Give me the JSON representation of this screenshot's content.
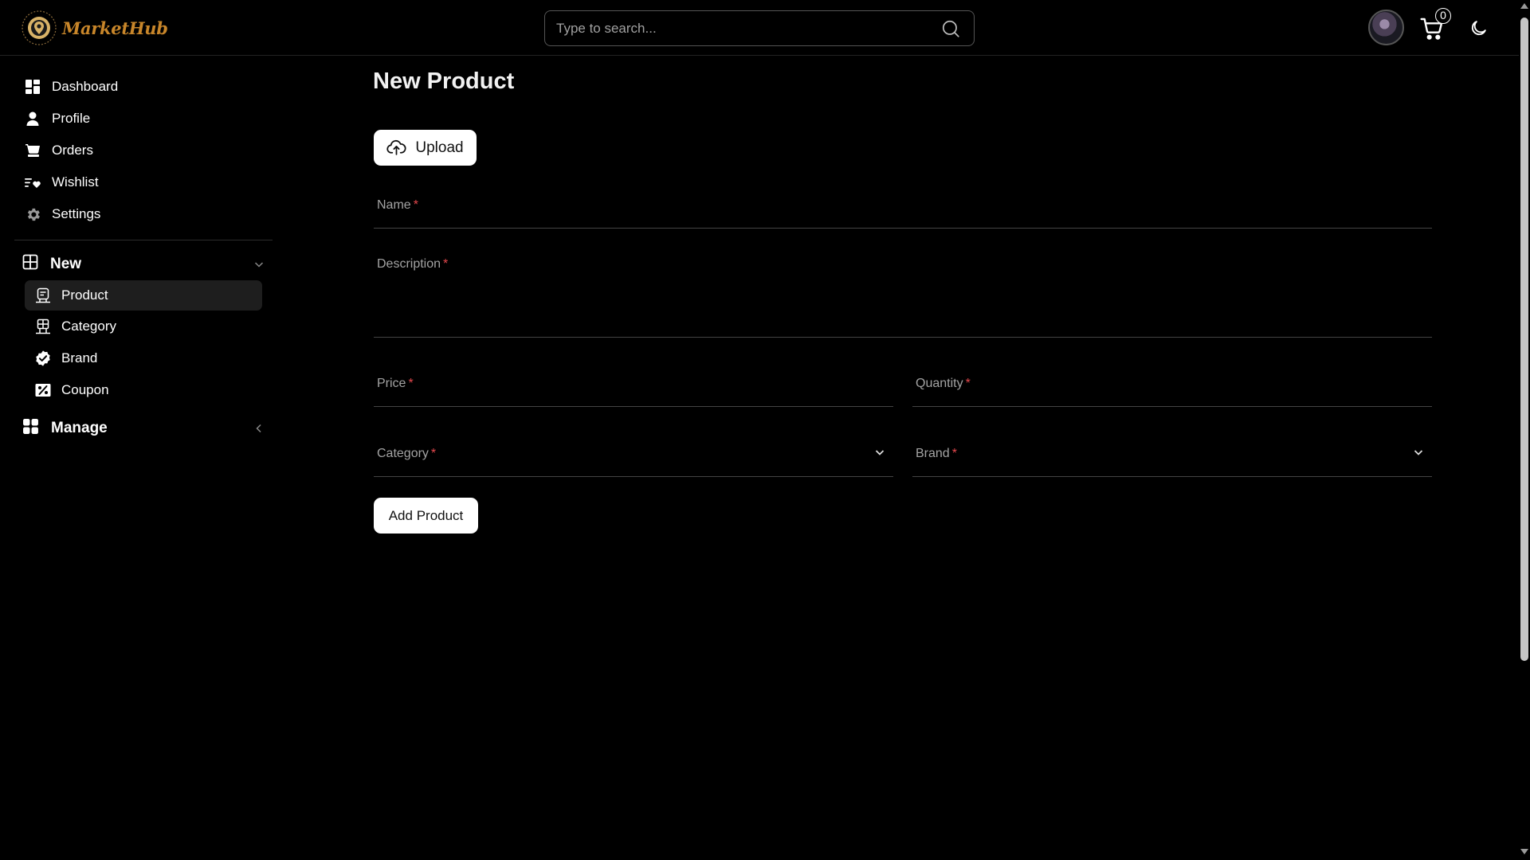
{
  "header": {
    "logo_text": "MarketHub",
    "search_placeholder": "Type to search...",
    "cart_count": "0",
    "icons": {
      "search": "search-icon",
      "cart": "cart-icon",
      "theme": "moon-icon",
      "avatar": "user-avatar"
    }
  },
  "sidebar": {
    "items": [
      {
        "label": "Dashboard",
        "icon": "dashboard-icon"
      },
      {
        "label": "Profile",
        "icon": "person-icon"
      },
      {
        "label": "Orders",
        "icon": "cart-icon"
      },
      {
        "label": "Wishlist",
        "icon": "wishlist-icon"
      },
      {
        "label": "Settings",
        "icon": "gear-icon"
      }
    ],
    "new_group": {
      "label": "New",
      "items": [
        {
          "label": "Product",
          "icon": "product-icon",
          "active": true
        },
        {
          "label": "Category",
          "icon": "category-icon"
        },
        {
          "label": "Brand",
          "icon": "badge-check-icon"
        },
        {
          "label": "Coupon",
          "icon": "coupon-icon"
        }
      ]
    },
    "manage_group": {
      "label": "Manage"
    }
  },
  "main": {
    "title": "New Product",
    "upload_label": "Upload",
    "fields": {
      "name": {
        "label": "Name",
        "value": ""
      },
      "description": {
        "label": "Description",
        "value": ""
      },
      "price": {
        "label": "Price",
        "value": ""
      },
      "quantity": {
        "label": "Quantity",
        "value": ""
      },
      "category": {
        "label": "Category",
        "value": ""
      },
      "brand": {
        "label": "Brand",
        "value": ""
      }
    },
    "required_marker": "*",
    "submit_label": "Add Product"
  },
  "colors": {
    "background": "#000000",
    "logo": "#c8862a",
    "required": "#e5484d",
    "button_bg": "#ffffff"
  }
}
